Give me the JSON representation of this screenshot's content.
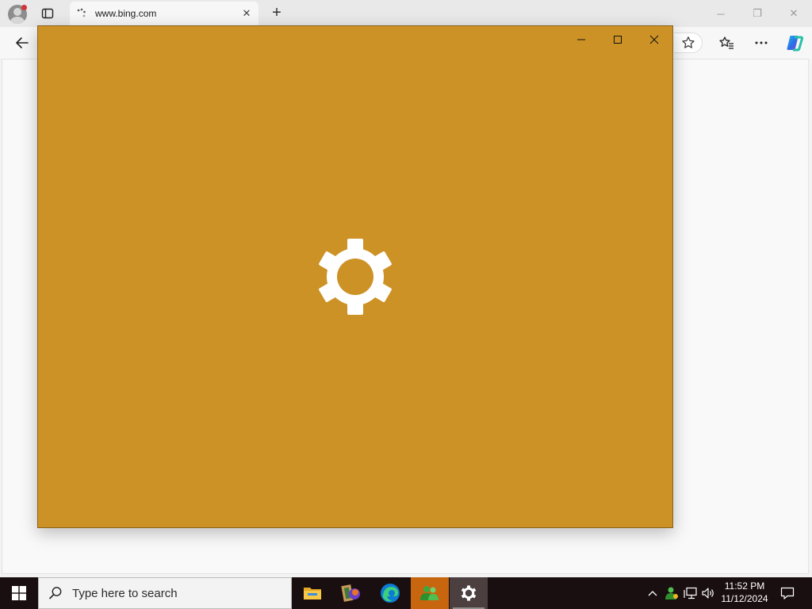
{
  "browser": {
    "tab_title": "www.bing.com",
    "tab_close_glyph": "✕",
    "new_tab_glyph": "+",
    "window_buttons": [
      "─",
      "❐",
      "✕"
    ],
    "toolbar_icons": [
      "back-arrow-icon",
      "star-icon",
      "favorites-icon",
      "more-icon",
      "copilot-icon"
    ]
  },
  "app_window": {
    "background": "#cd9226",
    "splash_icon": "gear-icon",
    "controls": [
      "minimize",
      "maximize",
      "close"
    ]
  },
  "taskbar": {
    "search_placeholder": "Type here to search",
    "apps": [
      "file-explorer-icon",
      "paint-icon",
      "edge-icon",
      "people-icon",
      "settings-icon"
    ],
    "time": "11:52 PM",
    "date": "11/12/2024"
  }
}
